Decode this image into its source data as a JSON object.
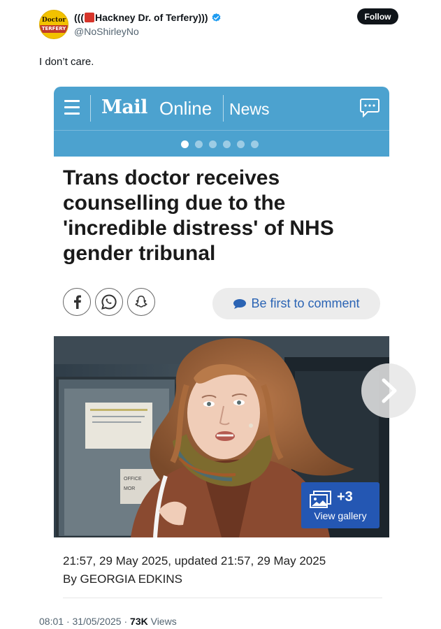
{
  "tweet": {
    "avatar_text_top": "Doctor",
    "avatar_text_bottom": "TERFERY",
    "display_name_prefix": "(((",
    "display_name_main": "Hackney Dr. of Terfery)))",
    "handle": "@NoShirleyNo",
    "follow_label": "Follow",
    "text": "I don’t care.",
    "time": "08:01",
    "date": "31/05/2025",
    "views_count": "73K",
    "views_label": "Views",
    "verified_color": "#1d9bf0"
  },
  "embed": {
    "logo_mail": "Mail",
    "logo_online": "Online",
    "section": "News",
    "headline": "Trans doctor receives counselling due to the 'incredible distress' of NHS gender tribunal",
    "comment_cta": "Be first to comment",
    "gallery_count": "+3",
    "gallery_label": "View gallery",
    "notice_lines": [
      "OFFICE",
      "MOR"
    ],
    "timestamp": "21:57, 29 May 2025, updated 21:57, 29 May 2025",
    "byline": "By GEORGIA EDKINS",
    "bar_color": "#4ca2cf",
    "link_color": "#2b64b4",
    "carousel_dots": 6,
    "active_dot": 1
  },
  "icons": [
    "verified-badge-icon",
    "hamburger-icon",
    "comment-icon",
    "facebook-icon",
    "whatsapp-icon",
    "snapchat-icon",
    "speech-bubble-icon",
    "gallery-icon",
    "chevron-right-icon"
  ]
}
